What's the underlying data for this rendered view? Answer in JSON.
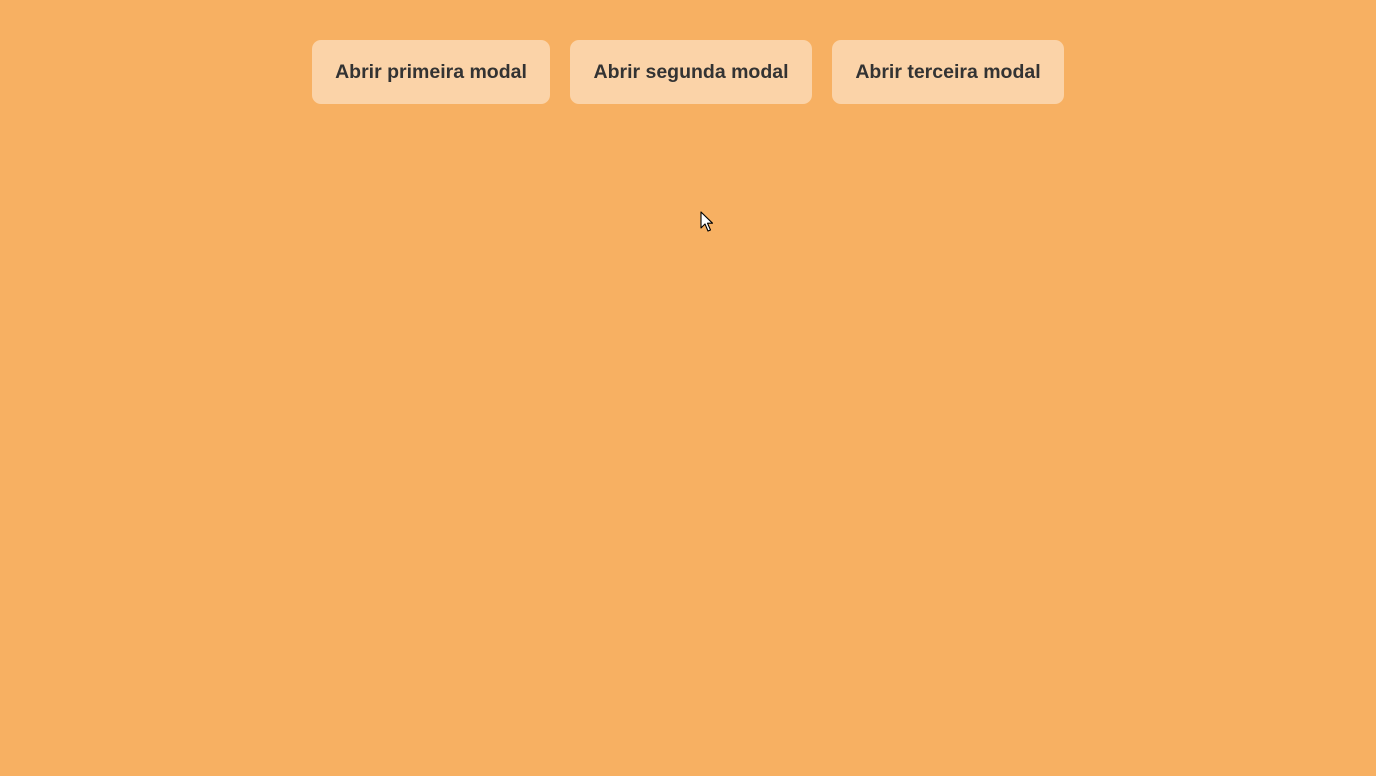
{
  "buttons": [
    {
      "label": "Abrir primeira modal"
    },
    {
      "label": "Abrir segunda modal"
    },
    {
      "label": "Abrir terceira modal"
    }
  ],
  "colors": {
    "background": "#f7b062",
    "button_background": "#fbd3a8",
    "button_text": "#333333"
  },
  "cursor": {
    "icon": "mouse-pointer-icon"
  }
}
